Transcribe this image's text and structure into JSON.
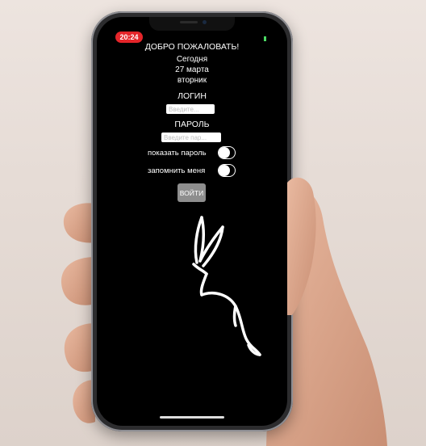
{
  "status_bar": {
    "time": "20:24"
  },
  "greeting": {
    "title": "ДОБРО ПОЖАЛОВАТЬ!"
  },
  "date_info": {
    "today": "Сегодня",
    "date": "27 марта",
    "weekday": "вторник"
  },
  "login": {
    "label": "ЛОГИН",
    "placeholder": "Введите...",
    "value": ""
  },
  "password": {
    "label": "ПАРОЛЬ",
    "placeholder": "Введите пар...",
    "value": ""
  },
  "toggles": [
    {
      "label": "показать пароль",
      "state": "off"
    },
    {
      "label": "запомнить меня",
      "state": "off"
    }
  ],
  "submit": {
    "label": "ВОЙТИ"
  },
  "illustration": {
    "icon": "rabbit-outline-icon"
  },
  "colors": {
    "screen_bg": "#000000",
    "time_badge": "#e5252a",
    "button_bg": "#8e8e8e",
    "text": "#ffffff"
  }
}
